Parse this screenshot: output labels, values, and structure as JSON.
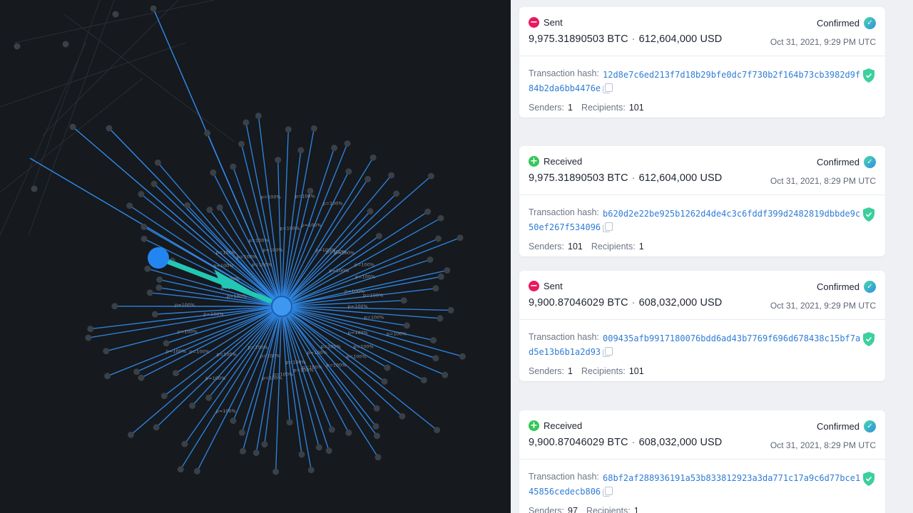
{
  "graph": {
    "edge_label": "p=100%",
    "hub_name": "center-address",
    "colors": {
      "background": "#16191d",
      "edge": "#2f8cf0",
      "hub": "#3f98f0",
      "node": "#3a4048",
      "highlight": "#22c7b5"
    }
  },
  "transactions": [
    {
      "direction": "Sent",
      "direction_icon": "minus-icon",
      "btc": "9,975.31890503 BTC",
      "usd": "612,604,000 USD",
      "status": "Confirmed",
      "date": "Oct 31, 2021, 9:29 PM UTC",
      "hash_label": "Transaction hash:",
      "hash": "12d8e7c6ed213f7d18b29bfe0dc7f730b2f164b73cb3982d9f84b2da6bb4476e",
      "senders_label": "Senders:",
      "senders": "1",
      "recipients_label": "Recipients:",
      "recipients": "101"
    },
    {
      "direction": "Received",
      "direction_icon": "plus-icon",
      "btc": "9,975.31890503 BTC",
      "usd": "612,604,000 USD",
      "status": "Confirmed",
      "date": "Oct 31, 2021, 8:29 PM UTC",
      "hash_label": "Transaction hash:",
      "hash": "b620d2e22be925b1262d4de4c3c6fddf399d2482819dbbde9c50ef267f534096",
      "senders_label": "Senders:",
      "senders": "101",
      "recipients_label": "Recipients:",
      "recipients": "1"
    },
    {
      "direction": "Sent",
      "direction_icon": "minus-icon",
      "btc": "9,900.87046029 BTC",
      "usd": "608,032,000 USD",
      "status": "Confirmed",
      "date": "Oct 31, 2021, 9:29 PM UTC",
      "hash_label": "Transaction hash:",
      "hash": "009435afb9917180076bdd6ad43b7769f696d678438c15bf7ad5e13b6b1a2d93",
      "senders_label": "Senders:",
      "senders": "1",
      "recipients_label": "Recipients:",
      "recipients": "101"
    },
    {
      "direction": "Received",
      "direction_icon": "plus-icon",
      "btc": "9,900.87046029 BTC",
      "usd": "608,032,000 USD",
      "status": "Confirmed",
      "date": "Oct 31, 2021, 8:29 PM UTC",
      "hash_label": "Transaction hash:",
      "hash": "68bf2af288936191a53b833812923a3da771c17a9c6d77bce145856cedecb806",
      "senders_label": "Senders:",
      "senders": "97",
      "recipients_label": "Recipients:",
      "recipients": "1"
    }
  ]
}
